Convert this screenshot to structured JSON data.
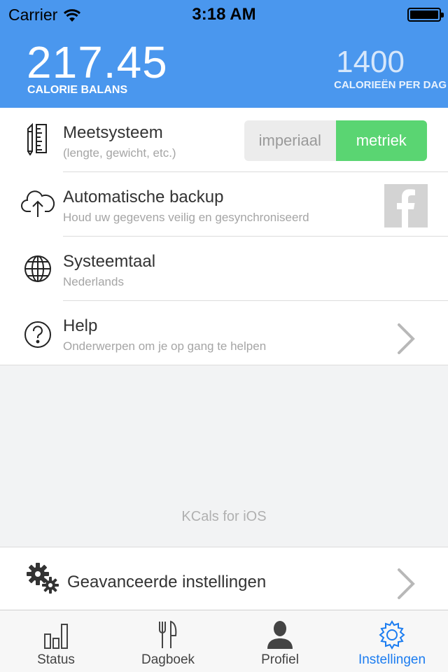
{
  "status_bar": {
    "carrier": "Carrier",
    "time": "3:18 AM",
    "battery_level": 1.0
  },
  "header": {
    "balance_value": "217.45",
    "balance_label": "CALORIE BALANS",
    "per_day_value": "1400",
    "per_day_label": "CALORIEËN PER DAG"
  },
  "settings": {
    "units": {
      "title": "Meetsysteem",
      "subtitle": "(lengte, gewicht, etc.)",
      "icon": "ruler-pencil-icon",
      "options": [
        "imperiaal",
        "metriek"
      ],
      "selected": "metriek"
    },
    "backup": {
      "title": "Automatische backup",
      "subtitle": "Houd uw gegevens veilig en gesynchroniseerd",
      "icon": "cloud-upload-icon",
      "service_icon": "facebook-icon"
    },
    "language": {
      "title": "Systeemtaal",
      "subtitle": "Nederlands",
      "icon": "globe-icon"
    },
    "help": {
      "title": "Help",
      "subtitle": "Onderwerpen om je op gang te helpen",
      "icon": "question-icon"
    }
  },
  "app_note": "KCals for iOS",
  "advanced": {
    "title": "Geavanceerde instellingen",
    "icon": "gears-icon"
  },
  "tabs": [
    {
      "label": "Status",
      "icon": "bar-chart-icon",
      "active": false
    },
    {
      "label": "Dagboek",
      "icon": "fork-knife-icon",
      "active": false
    },
    {
      "label": "Profiel",
      "icon": "person-icon",
      "active": false
    },
    {
      "label": "Instellingen",
      "icon": "gear-icon",
      "active": true
    }
  ],
  "colors": {
    "brand_blue": "#4a97ee",
    "toggle_green": "#5ad572",
    "active_tab": "#1b7cf0"
  }
}
